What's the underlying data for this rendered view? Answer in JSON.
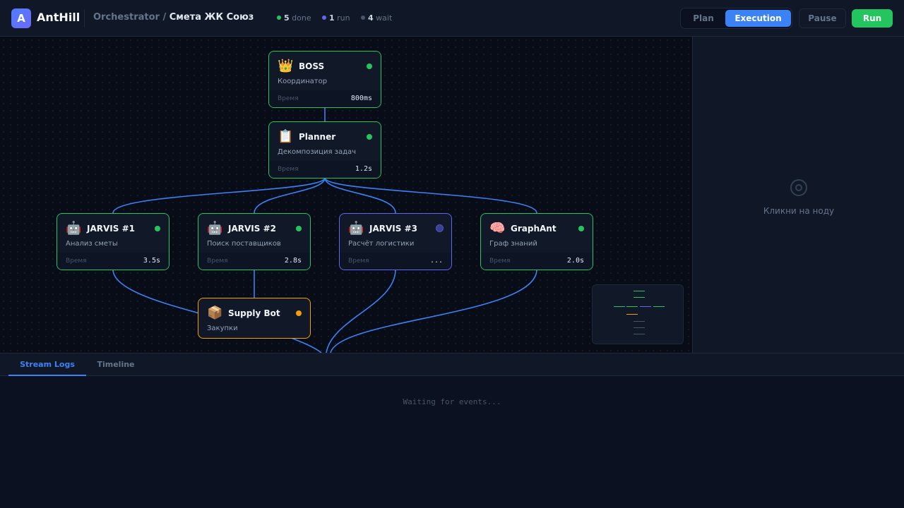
{
  "app": {
    "logo_letter": "A",
    "brand": "AntHill",
    "breadcrumb_root": "Orchestrator / ",
    "breadcrumb_current": "Смета ЖК Союз"
  },
  "stats": {
    "done": {
      "count": "5",
      "label": "done",
      "color": "#22c55e"
    },
    "run": {
      "count": "1",
      "label": "run",
      "color": "#6366f1"
    },
    "wait": {
      "count": "4",
      "label": "wait",
      "color": "#475569"
    }
  },
  "modes": {
    "plan": "Plan",
    "execution": "Execution",
    "active": "execution"
  },
  "actions": {
    "pause": "Pause",
    "run": "Run"
  },
  "nodes": [
    {
      "id": "boss",
      "emoji": "👑",
      "title": "BOSS",
      "subtitle": "Координатор",
      "time_label": "Время",
      "time": "800ms",
      "status": "done"
    },
    {
      "id": "planner",
      "emoji": "📋",
      "title": "Planner",
      "subtitle": "Декомпозиция задач",
      "time_label": "Время",
      "time": "1.2s",
      "status": "done"
    },
    {
      "id": "jarvis1",
      "emoji": "🤖",
      "title": "JARVIS #1",
      "subtitle": "Анализ сметы",
      "time_label": "Время",
      "time": "3.5s",
      "status": "done"
    },
    {
      "id": "jarvis2",
      "emoji": "🤖",
      "title": "JARVIS #2",
      "subtitle": "Поиск поставщиков",
      "time_label": "Время",
      "time": "2.8s",
      "status": "done"
    },
    {
      "id": "jarvis3",
      "emoji": "🤖",
      "title": "JARVIS #3",
      "subtitle": "Расчёт логистики",
      "time_label": "Время",
      "time": "...",
      "status": "run"
    },
    {
      "id": "graphant",
      "emoji": "🧠",
      "title": "GraphAnt",
      "subtitle": "Граф знаний",
      "time_label": "Время",
      "time": "2.0s",
      "status": "done"
    },
    {
      "id": "supply",
      "emoji": "📦",
      "title": "Supply Bot",
      "subtitle": "Закупки",
      "status": "wait"
    }
  ],
  "edges": [
    [
      "boss",
      "planner"
    ],
    [
      "planner",
      "jarvis1"
    ],
    [
      "planner",
      "jarvis2"
    ],
    [
      "planner",
      "jarvis3"
    ],
    [
      "planner",
      "graphant"
    ],
    [
      "jarvis1",
      "supply"
    ],
    [
      "jarvis2",
      "supply"
    ],
    [
      "jarvis3",
      "next"
    ],
    [
      "graphant",
      "next"
    ],
    [
      "supply",
      "next"
    ]
  ],
  "colors": {
    "edge": "#3b82f6",
    "done": "#22c55e",
    "run": "#6366f1",
    "wait": "#f59e0b"
  },
  "details": {
    "hint": "Кликни на ноду",
    "icon": "target-icon"
  },
  "logs": {
    "tabs": [
      {
        "id": "stream",
        "label": "Stream Logs"
      },
      {
        "id": "timeline",
        "label": "Timeline"
      }
    ],
    "active_tab": "stream",
    "empty": "Waiting for events..."
  }
}
